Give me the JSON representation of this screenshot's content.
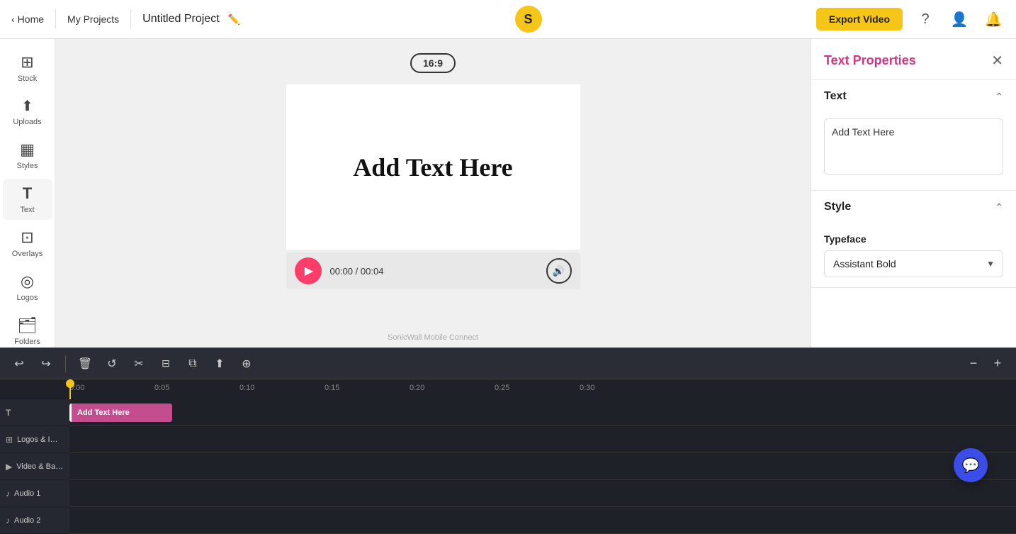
{
  "topbar": {
    "back_label": "Home",
    "projects_label": "My Projects",
    "project_name": "Untitled Project",
    "export_label": "Export Video",
    "logo_text": "S"
  },
  "sidebar": {
    "items": [
      {
        "id": "stock",
        "label": "Stock",
        "icon": "⊞"
      },
      {
        "id": "uploads",
        "label": "Uploads",
        "icon": "↑"
      },
      {
        "id": "styles",
        "label": "Styles",
        "icon": "▦"
      },
      {
        "id": "text",
        "label": "Text",
        "icon": "T"
      },
      {
        "id": "overlays",
        "label": "Overlays",
        "icon": "⊡"
      },
      {
        "id": "logos",
        "label": "Logos",
        "icon": "◎"
      },
      {
        "id": "folders",
        "label": "Folders",
        "icon": "📁"
      }
    ]
  },
  "canvas": {
    "aspect_ratio": "16:9",
    "preview_text": "Add Text Here",
    "time_current": "00:00",
    "time_total": "00:04"
  },
  "right_panel": {
    "title": "Text Properties",
    "sections": {
      "text": {
        "label": "Text",
        "value": "Add Text Here"
      },
      "style": {
        "label": "Style",
        "typeface_label": "Typeface",
        "typeface_value": "Assistant Bold"
      }
    }
  },
  "timeline": {
    "toolbar": {
      "undo": "↩",
      "redo": "↪",
      "delete": "🗑",
      "loop": "↺",
      "cut": "✂",
      "split": "⊟",
      "copy": "⧉",
      "align_up": "↑",
      "align_center": "⊕",
      "zoom_out": "−",
      "zoom_in": "+"
    },
    "ruler_marks": [
      "0:00",
      "0:05",
      "0:10",
      "0:15",
      "0:20",
      "0:25",
      "0:30"
    ],
    "tracks": [
      {
        "id": "text-track",
        "icon": "T",
        "label": "Add Text Here",
        "has_clip": true
      },
      {
        "id": "logos-track",
        "icon": "⊞",
        "label": "Logos & Image Overlays",
        "has_clip": false
      },
      {
        "id": "video-track",
        "icon": "▶",
        "label": "Video & Background Images",
        "has_clip": false
      },
      {
        "id": "audio1-track",
        "icon": "♪",
        "label": "Audio 1",
        "has_clip": false
      },
      {
        "id": "audio2-track",
        "icon": "♪",
        "label": "Audio 2",
        "has_clip": false
      }
    ]
  },
  "watermark": "SonicWall Mobile Connect",
  "chat_bubble_icon": "💬"
}
